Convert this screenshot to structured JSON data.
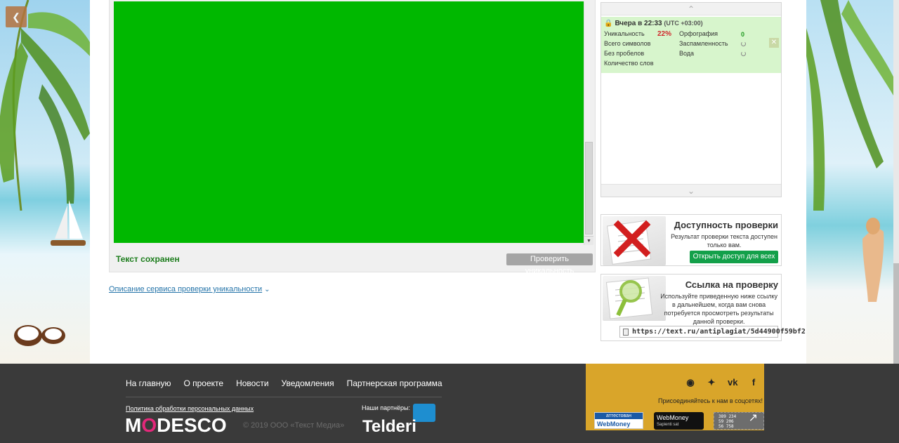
{
  "colors": {
    "editor_bg": "#00b800",
    "history_item_bg": "#d7f5cc",
    "footer_bg": "#3a3a3a",
    "social_box_bg": "#d9a52a",
    "link": "#2574a9",
    "open_btn": "#13a04a"
  },
  "icons": {
    "corner": "back-arrow-icon",
    "lock": "lock-icon",
    "doc": "document-icon",
    "chevron": "chevron-down-icon"
  },
  "editor": {
    "status": "Текст сохранен",
    "check_button": "Проверить уникальность"
  },
  "service_link": {
    "label": "Описание сервиса проверки уникальности"
  },
  "history": {
    "date": "Вчера в 22:33",
    "timezone": "(UTC +03:00)",
    "uniqueness_label": "Уникальность",
    "uniqueness_value": "22%",
    "total_chars_label": "Всего символов",
    "no_spaces_label": "Без пробелов",
    "words_label": "Количество слов",
    "spelling_label": "Орфография",
    "spelling_value": "0",
    "spam_label": "Заспамленность",
    "water_label": "Вода"
  },
  "access_card": {
    "title": "Доступность проверки",
    "desc_line1": "Результат проверки текста доступен",
    "desc_line2": "только вам.",
    "button": "Открыть доступ для всех"
  },
  "link_card": {
    "title": "Ссылка на проверку",
    "desc_line1": "Используйте приведенную ниже ссылку",
    "desc_line2": "в дальнейшем, когда вам снова",
    "desc_line3": "потребуется просмотреть результаты",
    "desc_line4": "данной проверки.",
    "url": "https://text.ru/antiplagiat/5d44900f59bf2"
  },
  "footer": {
    "nav": [
      "На главную",
      "О проекте",
      "Новости",
      "Уведомления",
      "Партнерская программа"
    ],
    "privacy": "Политика обработки персональных данных",
    "logo_m": "M",
    "logo_o": "O",
    "logo_rest": "DESCO",
    "copyright": "© 2019 ООО «Текст Медиа»",
    "partners_label": "Наши партнёры:",
    "telderi": "Telderi",
    "social_join": "Присоединяйтесь к нам в соцсетях!",
    "social_icons": [
      "instagram-icon",
      "twitter-icon",
      "vk-icon",
      "facebook-icon"
    ],
    "wm1_top": "аттестован",
    "wm1_bottom": "WebMoney",
    "wm2_top": "WebMoney",
    "wm2_sub": "Sapienti sat",
    "counter_line1": "389 234",
    "counter_line2": "59 206",
    "counter_line3": "56 758"
  }
}
